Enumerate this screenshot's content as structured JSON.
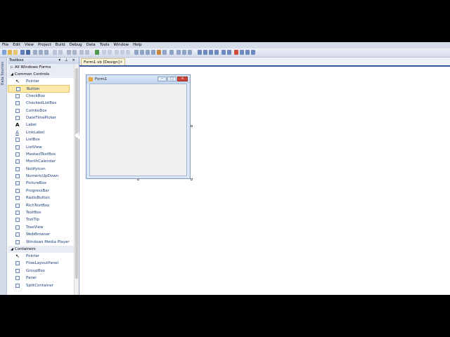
{
  "menu": [
    "File",
    "Edit",
    "View",
    "Project",
    "Build",
    "Debug",
    "Data",
    "Tools",
    "Window",
    "Help"
  ],
  "side_strip": {
    "label": "Data Sources"
  },
  "toolbox": {
    "title": "Toolbox",
    "header_buttons": "▾ ⊥ ×",
    "sections": [
      {
        "label": "All Windows Forms",
        "expanded": false,
        "items": []
      },
      {
        "label": "Common Controls",
        "expanded": true,
        "items": [
          "Pointer",
          "Button",
          "CheckBox",
          "CheckedListBox",
          "ComboBox",
          "DateTimePicker",
          "Label",
          "LinkLabel",
          "ListBox",
          "ListView",
          "MaskedTextBox",
          "MonthCalendar",
          "NotifyIcon",
          "NumericUpDown",
          "PictureBox",
          "ProgressBar",
          "RadioButton",
          "RichTextBox",
          "TextBox",
          "ToolTip",
          "TreeView",
          "WebBrowser",
          "Windows Media Player"
        ]
      },
      {
        "label": "Containers",
        "expanded": true,
        "items": [
          "Pointer",
          "FlowLayoutPanel",
          "GroupBox",
          "Panel",
          "SplitContainer"
        ]
      }
    ],
    "selected_item": "Button"
  },
  "editor": {
    "tab_label": "Form1.vb [Design]",
    "tab_close": "×",
    "form_title": "Form1",
    "window_buttons": {
      "minimize": "–",
      "maximize": "□",
      "close": "×"
    }
  },
  "colors": {
    "accent": "#37579b",
    "selection": "#fde9a8",
    "close_button": "#c9483a"
  }
}
